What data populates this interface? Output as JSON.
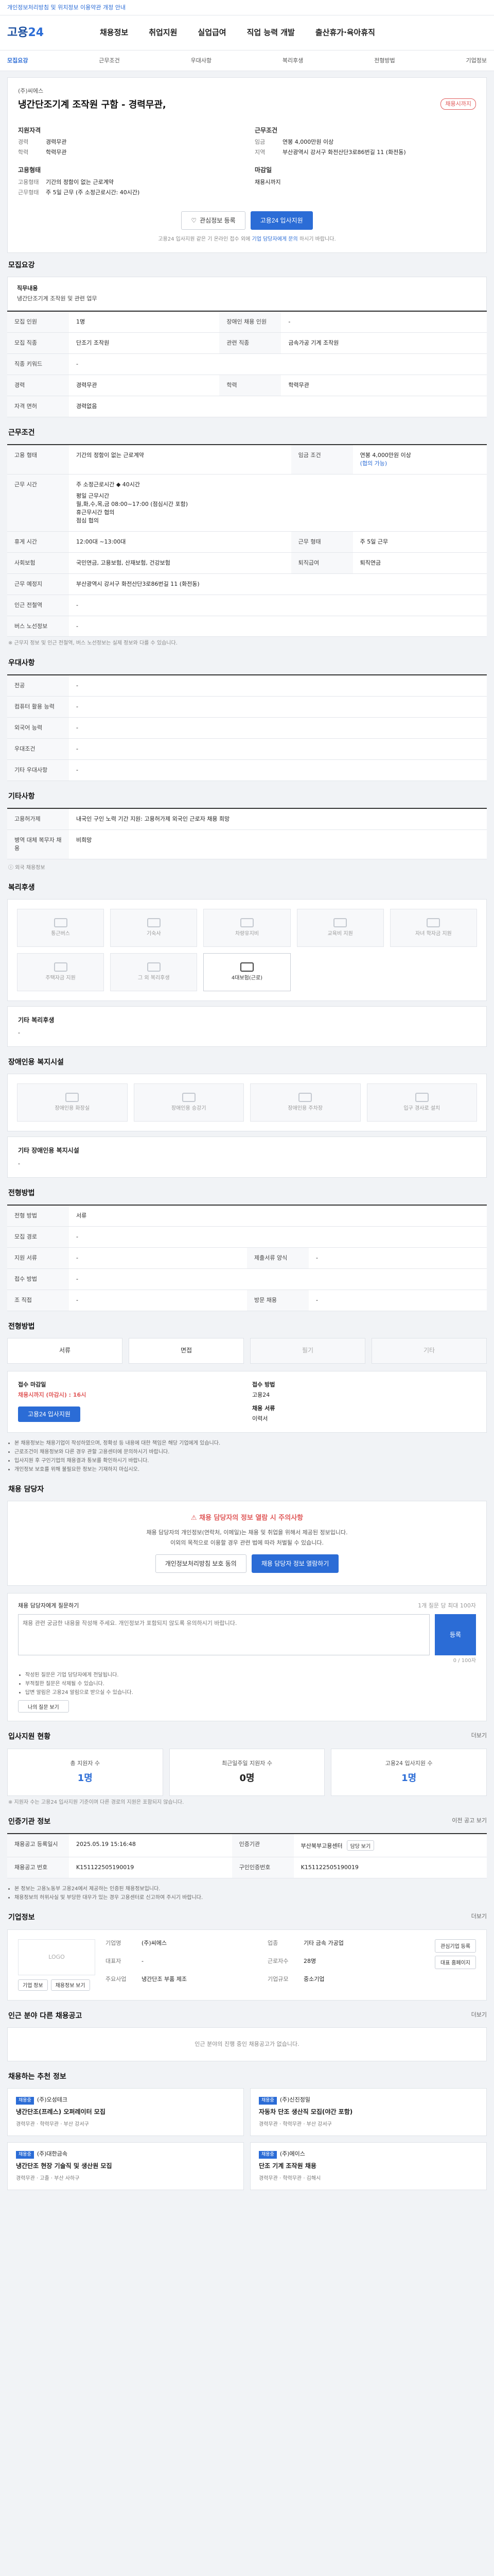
{
  "topbar": {
    "notice": "개인정보처리방침 및 위치정보 이용약관 개정 안내"
  },
  "header": {
    "logo_a": "고용",
    "logo_b": "24",
    "nav": [
      "채용정보",
      "취업지원",
      "실업급여",
      "직업 능력 개발",
      "출산휴가·육아휴직"
    ]
  },
  "subnav": {
    "items": [
      "모집요강",
      "근무조건",
      "우대사항",
      "복리후생",
      "전형방법",
      "기업정보"
    ],
    "active_index": 0
  },
  "job": {
    "company": "(주)씨에스",
    "title": "냉간단조기계 조작원 구함 - 경력무관,",
    "dday": "채용시까지",
    "summary_left_title1": "지원자격",
    "k_career": "경력",
    "v_career": "경력무관",
    "k_edu": "학력",
    "v_edu": "학력무관",
    "summary_left_title2": "고용형태",
    "k_employ": "고용형태",
    "v_employ": "기간의 정함이 없는 근로계약",
    "k_hours": "근무형태",
    "v_hours": "주 5일 근무 (주 소정근로시간: 40시간)",
    "summary_right_title1": "근무조건",
    "k_pay": "임금",
    "v_pay": "연봉 4,000만원 이상",
    "k_place": "지역",
    "v_place": "부산광역시 강서구 화전산단3로86번길 11 (화전동)",
    "summary_right_title2": "마감일",
    "v_deadline": "채용시까지"
  },
  "buttons": {
    "scrap": "관심정보 등록",
    "apply": "고용24 입사지원",
    "fine_a": "고용24 입사지원 같은 기 온라인 접수 외에",
    "fine_blue": "기업 담당자에게 문의",
    "fine_b": "하시기 바랍니다."
  },
  "recruit": {
    "title": "모집요강",
    "job_title_lbl": "직무내용",
    "job_title_val": "냉간단조기계 조작원 및 관련 업무",
    "rows": [
      {
        "k": "모집 인원",
        "v": "1명",
        "k2": "장애인 채용 인원",
        "v2": "-"
      },
      {
        "k": "모집 직종",
        "v": "단조기 조작원",
        "k2": "관련 직종",
        "v2": "금속가공 기계 조작원"
      },
      {
        "k": "직종 키워드",
        "v": "-",
        "k2": "",
        "v2": ""
      },
      {
        "k": "경력",
        "v": "경력무관",
        "k2": "학력",
        "v2": "학력무관"
      },
      {
        "k": "자격 면허",
        "v": "경력없음",
        "k2": "",
        "v2": ""
      }
    ]
  },
  "cond": {
    "title": "근무조건",
    "employ_lbl": "고용 형태",
    "employ_val": "기간의 정함이 없는 근로계약",
    "pay_lbl": "임금 조건",
    "pay_val": "연봉 4,000만원 이상",
    "pay_note": "(협의 가능)",
    "work_lbl": "근무 시간",
    "work_line1": "주 소정근로시간 ◆ 40시간",
    "work_line2": "평일 근무시간",
    "work_line3": "월,화,수,목,금 08:00~17:00 (점심시간 포함)",
    "work_line4": "휴근무시간 협의",
    "work_line5": "점심 협의",
    "rows": [
      {
        "k": "휴게 시간",
        "v": "12:00대 ~13:00대",
        "k2": "근무 형태",
        "v2": "주 5일 근무"
      },
      {
        "k": "사회보험",
        "v": "국민연금, 고용보험, 산재보험, 건강보험",
        "k2": "퇴직급여",
        "v2": "퇴직연금"
      },
      {
        "k": "근무 예정지",
        "v": "부산광역시 강서구 화전산단3로86번길 11 (화전동)",
        "k2": "",
        "v2": ""
      },
      {
        "k": "인근 전철역",
        "v": "-",
        "k2": "",
        "v2": ""
      },
      {
        "k": "버스 노선정보",
        "v": "-",
        "k2": "",
        "v2": ""
      }
    ],
    "note": "※ 근무지 정보 및 인근 전철역, 버스 노선정보는 실제 정보와 다를 수 있습니다."
  },
  "pref": {
    "title": "우대사항",
    "rows": [
      {
        "k": "전공",
        "v": "-"
      },
      {
        "k": "컴퓨터 활용 능력",
        "v": "-"
      },
      {
        "k": "외국어 능력",
        "v": "-"
      },
      {
        "k": "우대조건",
        "v": "-"
      },
      {
        "k": "기타 우대사항",
        "v": "-"
      }
    ]
  },
  "etc": {
    "title": "기타사항",
    "rows": [
      {
        "k": "고용허가제",
        "v": "내국인 구인 노력 기간 지원: 고용허가제 외국인 근로자 채용 희망"
      },
      {
        "k": "병역 대체 복무자 채용",
        "v": "비희망"
      }
    ],
    "extra": "외국 채용정보"
  },
  "welfare": {
    "title": "복리후생",
    "items": [
      "통근버스",
      "기숙사",
      "차량유지비",
      "교육비 지원",
      "자녀 학자금 지원",
      "주택자금 지원",
      "그 외 복리후생",
      "4대보험(근로)"
    ],
    "other_title": "기타 복리후생",
    "other_val": "-"
  },
  "disab": {
    "title": "장애인용 복지시설",
    "items": [
      "장애인용 화장실",
      "장애인용 승강기",
      "장애인용 주차장",
      "입구 경사로 설치"
    ],
    "other_title": "기타 장애인용 복지시설",
    "other_val": "-"
  },
  "screen": {
    "title": "전형방법",
    "rows": [
      {
        "k": "전형 방법",
        "v": "서류",
        "k2": "",
        "v2": ""
      },
      {
        "k": "모집 경로",
        "v": "-",
        "k2": "",
        "v2": ""
      },
      {
        "k": "지원 서류",
        "v": "-",
        "k2": "제출서류 양식",
        "v2": "-"
      },
      {
        "k": "접수 방법",
        "v": "-",
        "k2": "",
        "v2": ""
      },
      {
        "k": "조 직접",
        "v": "-",
        "k2": "방문 채용",
        "v2": "-"
      }
    ]
  },
  "steps": {
    "title": "전형방법",
    "items": [
      "서류",
      "면접",
      "필기",
      "기타"
    ],
    "apply_h1": "접수 마감일",
    "apply_v1": "채용시까지 (마감시) : 16시",
    "apply_h2": "접수 방법",
    "apply_v2": "고용24",
    "apply_h3": "채용 서류",
    "apply_v3": "이력서",
    "apply_btn": "고용24 입사지원",
    "bullets": [
      "본 채용정보는 채용기업이 작성하였으며, 정확성 등 내용에 대한 책임은 해당 기업에게 있습니다.",
      "근로조건이 채용정보와 다른 경우 관할 고용센터에 문의하시기 바랍니다.",
      "입사지원 후 구인기업의 채용결과 통보를 확인하시기 바랍니다.",
      "개인정보 보호를 위해 불필요한 정보는 기재하지 마십시오."
    ]
  },
  "contact": {
    "title": "채용 담당자",
    "alert": "채용 담당자의 정보 열람 시 주의사항",
    "p1": "채용 담당자의 개인정보(연락처, 이메일)는 채용 및 취업을 위해서 제공된 정보입니다.",
    "p2": "이외의 목적으로 이용할 경우 관련 법에 따라 처벌될 수 있습니다.",
    "btn1": "개인정보처리방침 보호 동의",
    "btn2": "채용 담당자 정보 열람하기",
    "qa_title": "채용 담당자에게 질문하기",
    "qa_limit": "1개 질문 당 최대 100자",
    "qa_placeholder": "채용 관련 궁금한 내용을 작성해 주세요. 개인정보가 포함되지 않도록 유의하시기 바랍니다.",
    "qa_submit": "등록",
    "qa_count": "0 / 100자",
    "qa_notes": [
      "작성된 질문은 기업 담당자에게 전달됩니다.",
      "부적절한 질문은 삭제될 수 있습니다.",
      "답변 알림은 고용24 알림으로 받으실 수 있습니다."
    ],
    "qa_more": "나의 질문 보기"
  },
  "status": {
    "title": "입사지원 현황",
    "more": "더보기",
    "stats": [
      {
        "lbl": "총 지원자 수",
        "val": "1명"
      },
      {
        "lbl": "최근일주일 지원자 수",
        "val": "0명"
      },
      {
        "lbl": "고용24 입사지원 수",
        "val": "1명"
      }
    ],
    "note": "※ 지원자 수는 고용24 입사지원 기준이며 다른 경로의 지원은 포함되지 않습니다."
  },
  "info": {
    "title": "인증기관 정보",
    "btn": "이전 공고 보기",
    "rows": [
      {
        "k": "채용공고 등록일시",
        "v": "2025.05.19 15:16:48",
        "k2": "인증기관",
        "v2": "부산북부고용센터",
        "btn": "담당 보기"
      },
      {
        "k": "채용공고 번호",
        "v": "K151122505190019",
        "k2": "구인인증번호",
        "v2": "K151122505190019"
      }
    ],
    "notes": [
      "본 정보는 고용노동부 고용24에서 제공하는 인증된 채용정보입니다.",
      "채용정보의 허위사실 및 부당한 대우가 있는 경우 고용센터로 신고하여 주시기 바랍니다."
    ]
  },
  "company": {
    "title": "기업정보",
    "more": "더보기",
    "logo": "LOGO",
    "k1": "기업명",
    "v1": "(주)씨에스",
    "k2": "업종",
    "v2": "기타 금속 가공업",
    "k3": "대표자",
    "v3": "-",
    "k4": "근로자수",
    "v4": "28명",
    "k5": "주요사업",
    "v5": "냉간단조 부품 제조",
    "k6": "기업규모",
    "v6": "중소기업",
    "btn1": "기업 정보",
    "btn2": "채용정보 보기",
    "btn3": "관심기업 등록",
    "visit": "대표 홈페이지"
  },
  "otherjobs": {
    "title": "인근 분야 다른 채용공고",
    "more": "더보기",
    "empty": "인근 분야의 진행 중인 채용공고가 없습니다."
  },
  "recs": {
    "title": "채용하는 추천 정보",
    "items": [
      {
        "tag": "채용중",
        "company": "(주)오성테크",
        "title": "냉간단조(프레스) 오퍼레이터 모집",
        "meta": "경력무관 · 학력무관 · 부산 강서구"
      },
      {
        "tag": "채용중",
        "company": "(주)신진정밀",
        "title": "자동차 단조 생산직 모집(야간 포함)",
        "meta": "경력무관 · 학력무관 · 부산 강서구"
      },
      {
        "tag": "채용중",
        "company": "(주)대한금속",
        "title": "냉간단조 현장 기술직 및 생산원 모집",
        "meta": "경력무관 · 고졸 · 부산 사하구"
      },
      {
        "tag": "채용중",
        "company": "(주)에이스",
        "title": "단조 기계 조작원 채용",
        "meta": "경력무관 · 학력무관 · 김해시"
      }
    ]
  }
}
